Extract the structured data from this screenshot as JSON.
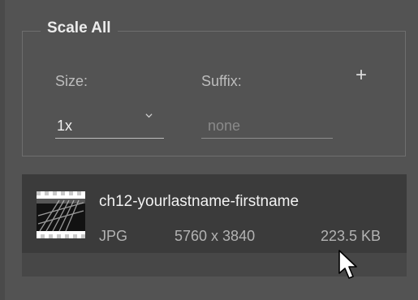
{
  "scale_all": {
    "title": "Scale All",
    "size_label": "Size:",
    "suffix_label": "Suffix:",
    "add_label": "+",
    "size_value": "1x",
    "suffix_placeholder": "none"
  },
  "asset": {
    "name": "ch12-yourlastname-firstname",
    "type": "JPG",
    "dimensions": "5760 x 3840",
    "file_size": "223.5 KB"
  },
  "icons": {
    "size_dropdown": "chevron-down-icon",
    "add": "plus-icon",
    "pointer": "mouse-pointer-icon"
  },
  "colors": {
    "panel_bg": "#535353",
    "row_bg": "#3b3b3b",
    "list_bg": "#474747",
    "text": "#f2f2f2",
    "muted_text": "#b3b3b3"
  }
}
